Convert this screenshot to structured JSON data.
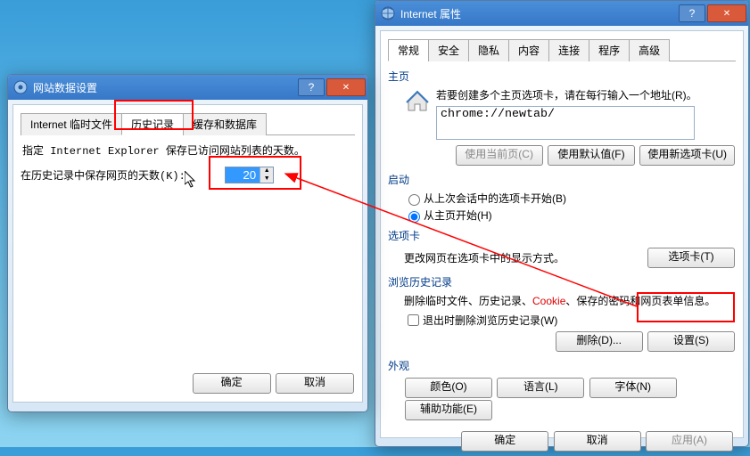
{
  "dialog_left": {
    "title": "网站数据设置",
    "tabs": [
      "Internet 临时文件",
      "历史记录",
      "缓存和数据库"
    ],
    "active_tab_index": 1,
    "description": "指定 Internet Explorer 保存已访问网站列表的天数。",
    "days_label": "在历史记录中保存网页的天数(K):",
    "days_value": "20",
    "ok": "确定",
    "cancel": "取消"
  },
  "dialog_right": {
    "title": "Internet 属性",
    "tabs": [
      "常规",
      "安全",
      "隐私",
      "内容",
      "连接",
      "程序",
      "高级"
    ],
    "active_tab_index": 0,
    "home": {
      "title": "主页",
      "desc": "若要创建多个主页选项卡，请在每行输入一个地址(R)。",
      "url_value": "chrome://newtab/",
      "btn_current": "使用当前页(C)",
      "btn_default": "使用默认值(F)",
      "btn_newtab": "使用新选项卡(U)"
    },
    "startup": {
      "title": "启动",
      "opt_last": "从上次会话中的选项卡开始(B)",
      "opt_home": "从主页开始(H)",
      "selected": 1
    },
    "tabs_section": {
      "title": "选项卡",
      "desc": "更改网页在选项卡中的显示方式。",
      "btn": "选项卡(T)"
    },
    "history": {
      "title": "浏览历史记录",
      "desc_prefix": "删除临时文件、历史记录、",
      "cookie": "Cookie",
      "desc_suffix": "、保存的密码和网页表单信息。",
      "chk": "退出时删除浏览历史记录(W)",
      "btn_delete": "删除(D)...",
      "btn_settings": "设置(S)"
    },
    "appearance": {
      "title": "外观",
      "btn_colors": "颜色(O)",
      "btn_lang": "语言(L)",
      "btn_fonts": "字体(N)",
      "btn_access": "辅助功能(E)"
    },
    "footer": {
      "ok": "确定",
      "cancel": "取消",
      "apply": "应用(A)"
    }
  }
}
